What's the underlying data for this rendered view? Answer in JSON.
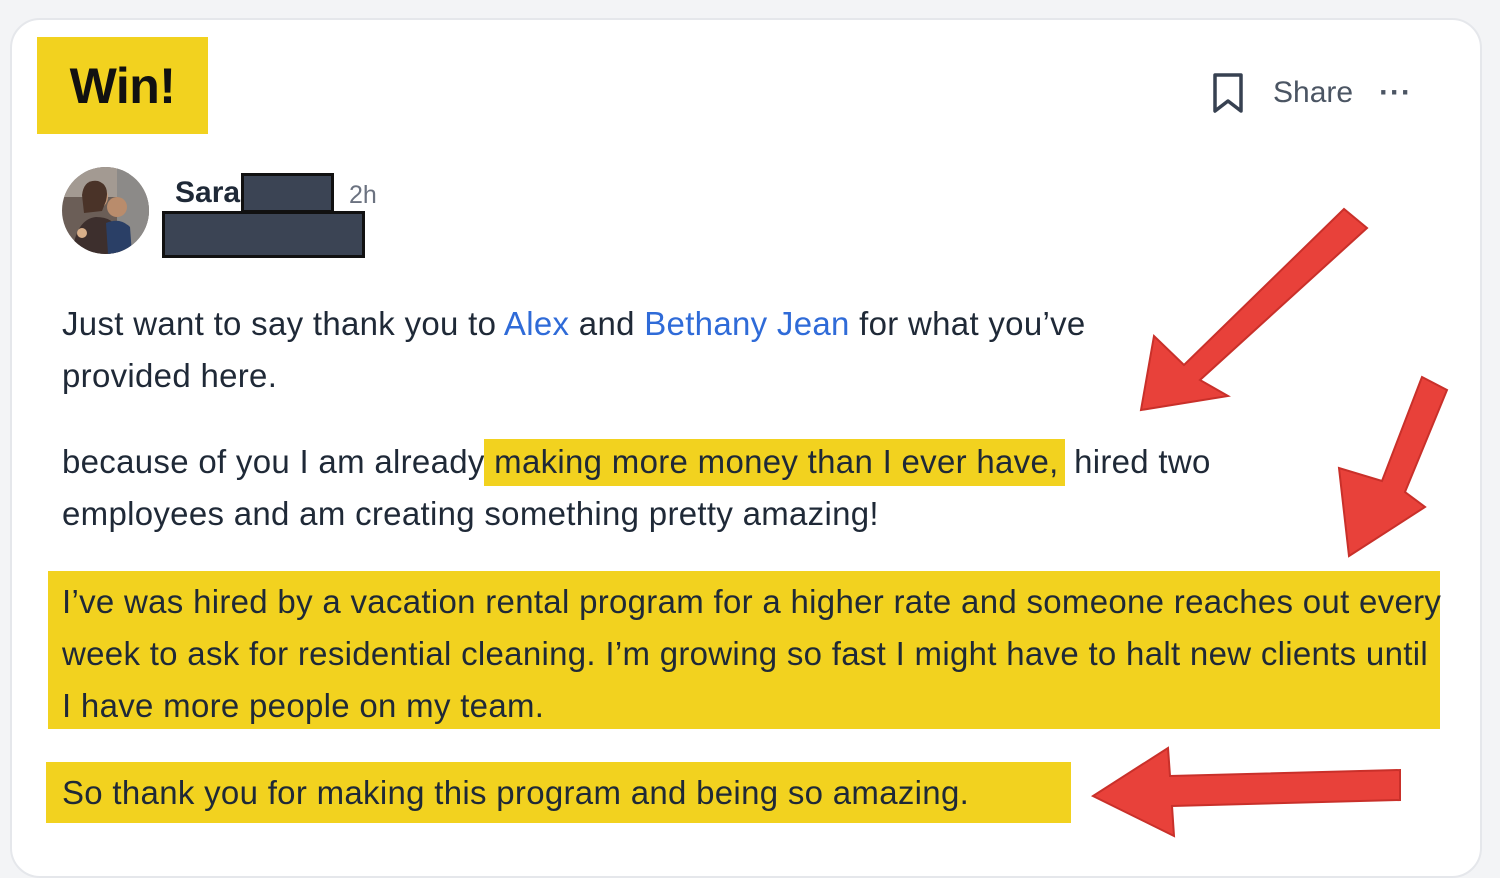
{
  "post": {
    "tag": "Win!",
    "author_first_name": "Sara",
    "time_ago": "2h",
    "actions": {
      "bookmark_icon": "bookmark-icon",
      "share_label": "Share",
      "more_label": "···"
    }
  },
  "body": {
    "p1": {
      "t1": "Just want to say thank you to ",
      "link1": "Alex",
      "t2": " and ",
      "link2": "Bethany Jean",
      "t3": " for what you’ve provided here."
    },
    "p2": {
      "t1": "because of you I am already ",
      "highlight": "making more money than I ever have,",
      "t2": " hired two employees and am creating something pretty amazing!"
    },
    "p3": "I’ve was hired by a vacation rental program for a higher rate and someone reaches out every week to ask for residential cleaning. I’m growing so fast I might have to halt new clients until I have more people on my team.",
    "p4": "So thank you for making this program and being so amazing."
  },
  "colors": {
    "highlight": "#f2d21f",
    "link": "#2f6bd8",
    "arrow": "#e8413a",
    "redaction": "#3b4454"
  }
}
